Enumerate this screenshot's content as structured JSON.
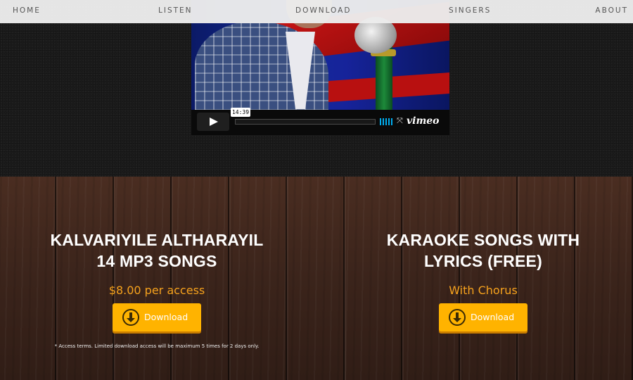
{
  "nav": {
    "items": [
      {
        "label": "HOME"
      },
      {
        "label": "LISTEN"
      },
      {
        "label": "DOWNLOAD"
      },
      {
        "label": "SINGERS"
      },
      {
        "label": "ABOUT"
      }
    ]
  },
  "video": {
    "timestamp": "14:39",
    "brand": "vimeo",
    "play_icon": "play-icon",
    "fullscreen_icon": "fullscreen-icon"
  },
  "products": [
    {
      "title_line1": "KALVARIYILE ALTHARAYIL",
      "title_line2": "14 MP3 SONGS",
      "price": "$8.00 per access",
      "button_label": "Download",
      "note": "* Access terms. Limited download access will be maximum 5 times for 2 days only."
    },
    {
      "title_line1": "KARAOKE SONGS WITH",
      "title_line2": "LYRICS (FREE)",
      "price": "With Chorus",
      "button_label": "Download"
    }
  ],
  "colors": {
    "accent": "#ffb300",
    "price_text": "#f6a21d",
    "nav_bg": "#ececec"
  }
}
